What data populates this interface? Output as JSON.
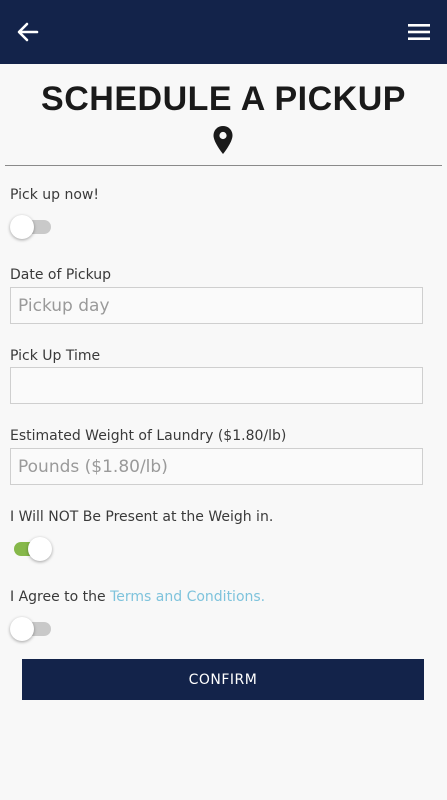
{
  "header": {
    "back_icon": "arrow-left-icon",
    "menu_icon": "hamburger-menu-icon",
    "bar_color": "#13234a"
  },
  "page": {
    "title": "SCHEDULE A PICKUP",
    "title_icon": "map-pin-icon"
  },
  "form": {
    "pickup_now": {
      "label": "Pick up now!",
      "checked": false
    },
    "date": {
      "label": "Date of Pickup",
      "placeholder": "Pickup day",
      "value": ""
    },
    "time": {
      "label": "Pick Up Time",
      "placeholder": "",
      "value": ""
    },
    "weight": {
      "label": "Estimated Weight of Laundry ($1.80/lb)",
      "placeholder": "Pounds ($1.80/lb)",
      "value": ""
    },
    "not_present": {
      "label": "I Will NOT Be Present at the Weigh in.",
      "checked": true
    },
    "agree": {
      "label_prefix": "I Agree to the ",
      "link_text": "Terms and Conditions.",
      "checked": false
    }
  },
  "confirm_label": "CONFIRM",
  "colors": {
    "primary": "#13234a",
    "toggle_on": "#86b84a",
    "link": "#7ec3dc"
  }
}
